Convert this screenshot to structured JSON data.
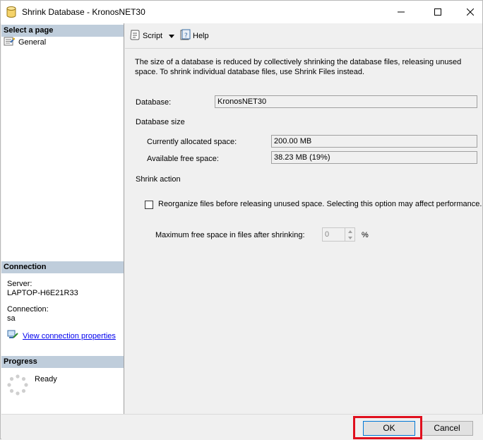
{
  "window": {
    "title": "Shrink Database - KronosNET30"
  },
  "sidebar": {
    "select_page_header": "Select a page",
    "pages": [
      {
        "label": "General",
        "icon": "page-wrench-icon"
      }
    ],
    "connection_header": "Connection",
    "server_label": "Server:",
    "server_value": "LAPTOP-H6E21R33",
    "connection_label": "Connection:",
    "connection_value": "sa",
    "view_connection_link": "View connection properties",
    "progress_header": "Progress",
    "progress_status": "Ready"
  },
  "toolbar": {
    "script_label": "Script",
    "help_label": "Help"
  },
  "main": {
    "description": "The size of a database is reduced by collectively shrinking the database files, releasing unused space. To shrink individual database files, use Shrink Files instead.",
    "database_label": "Database:",
    "database_value": "KronosNET30",
    "database_size_header": "Database size",
    "allocated_label": "Currently allocated space:",
    "allocated_value": "200.00 MB",
    "free_label": "Available free space:",
    "free_value": "38.23 MB (19%)",
    "shrink_action_header": "Shrink action",
    "reorganize_label": "Reorganize files before releasing unused space.  Selecting this option may affect performance.",
    "reorganize_checked": false,
    "max_free_label": "Maximum free space in files after shrinking:",
    "max_free_value": "0",
    "max_free_unit": "%"
  },
  "footer": {
    "ok_label": "OK",
    "cancel_label": "Cancel"
  },
  "colors": {
    "section_header_bg": "#bfcddb",
    "highlight": "#e0101e",
    "link": "#0000ee"
  }
}
